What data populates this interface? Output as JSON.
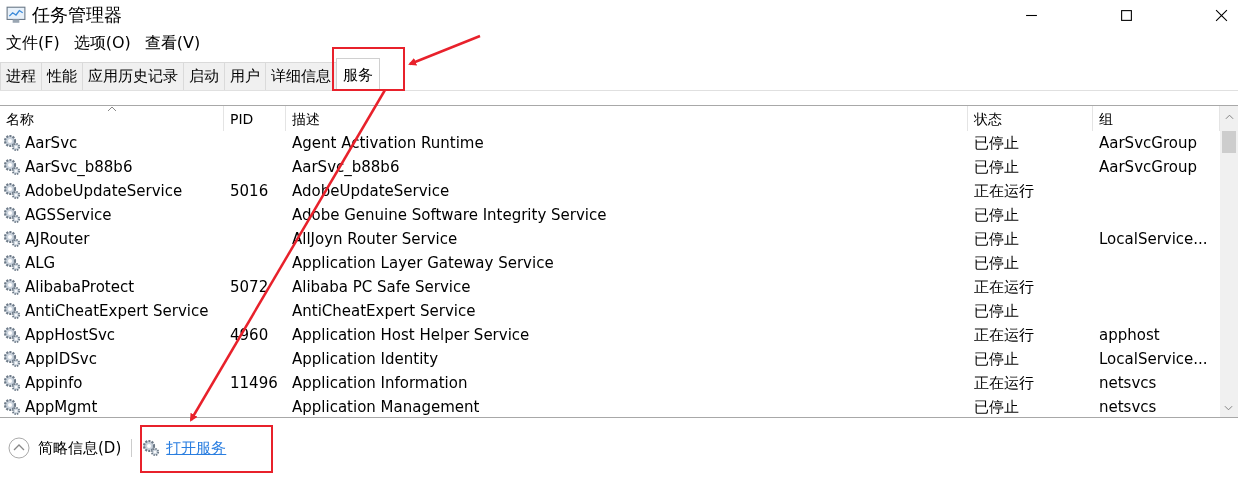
{
  "window": {
    "title": "任务管理器"
  },
  "menu": [
    "文件(F)",
    "选项(O)",
    "查看(V)"
  ],
  "tabs": [
    {
      "label": "进程",
      "selected": false
    },
    {
      "label": "性能",
      "selected": false
    },
    {
      "label": "应用历史记录",
      "selected": false
    },
    {
      "label": "启动",
      "selected": false
    },
    {
      "label": "用户",
      "selected": false
    },
    {
      "label": "详细信息",
      "selected": false
    },
    {
      "label": "服务",
      "selected": true
    }
  ],
  "table": {
    "columns": [
      "名称",
      "PID",
      "描述",
      "状态",
      "组"
    ],
    "rows": [
      {
        "name": "AarSvc",
        "pid": "",
        "description": "Agent Activation Runtime",
        "status": "已停止",
        "group": "AarSvcGroup"
      },
      {
        "name": "AarSvc_b88b6",
        "pid": "",
        "description": "AarSvc_b88b6",
        "status": "已停止",
        "group": "AarSvcGroup"
      },
      {
        "name": "AdobeUpdateService",
        "pid": "5016",
        "description": "AdobeUpdateService",
        "status": "正在运行",
        "group": ""
      },
      {
        "name": "AGSService",
        "pid": "",
        "description": "Adobe Genuine Software Integrity Service",
        "status": "已停止",
        "group": ""
      },
      {
        "name": "AJRouter",
        "pid": "",
        "description": "AllJoyn Router Service",
        "status": "已停止",
        "group": "LocalService..."
      },
      {
        "name": "ALG",
        "pid": "",
        "description": "Application Layer Gateway Service",
        "status": "已停止",
        "group": ""
      },
      {
        "name": "AlibabaProtect",
        "pid": "5072",
        "description": "Alibaba PC Safe Service",
        "status": "正在运行",
        "group": ""
      },
      {
        "name": "AntiCheatExpert Service",
        "pid": "",
        "description": "AntiCheatExpert Service",
        "status": "已停止",
        "group": ""
      },
      {
        "name": "AppHostSvc",
        "pid": "4960",
        "description": "Application Host Helper Service",
        "status": "正在运行",
        "group": "apphost"
      },
      {
        "name": "AppIDSvc",
        "pid": "",
        "description": "Application Identity",
        "status": "已停止",
        "group": "LocalService..."
      },
      {
        "name": "Appinfo",
        "pid": "11496",
        "description": "Application Information",
        "status": "正在运行",
        "group": "netsvcs"
      },
      {
        "name": "AppMgmt",
        "pid": "",
        "description": "Application Management",
        "status": "已停止",
        "group": "netsvcs"
      }
    ]
  },
  "footer": {
    "details_toggle": "简略信息(D)",
    "open_services_link": "打开服务"
  }
}
